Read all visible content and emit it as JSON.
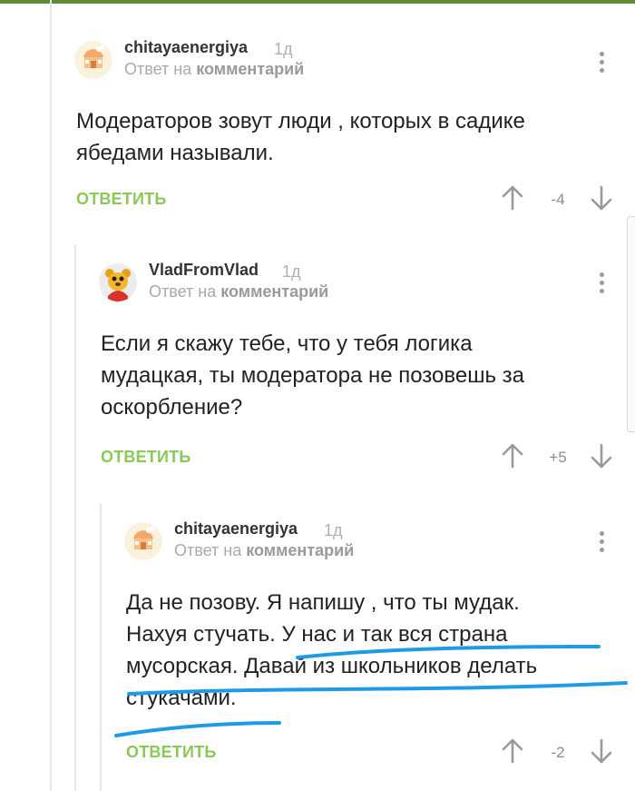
{
  "common": {
    "reply_to_prefix": "Ответ на",
    "reply_to_link": "комментарий",
    "reply_button": "ОТВЕТИТЬ"
  },
  "comments": [
    {
      "author": "chitayaenergiya",
      "time": "1д",
      "lines": [
        "Модераторов зовут люди , которых в садике",
        "ябедами называли."
      ],
      "rating": "-4"
    },
    {
      "author": "VladFromVlad",
      "time": "1д",
      "lines": [
        "Если я скажу тебе, что у тебя логика",
        "мудацкая, ты модератора не позовешь за",
        "оскорбление?"
      ],
      "rating": "+5"
    },
    {
      "author": "chitayaenergiya",
      "time": "1д",
      "lines": [
        "Да не позову. Я напишу , что ты мудак.",
        "Нахуя стучать.  У нас и так вся страна",
        "мусорская. Давай из школьников делать",
        "стукачами."
      ],
      "rating": "-2"
    }
  ],
  "colors": {
    "reply_button": "#8ac858",
    "highlight_stroke": "#1e9be6",
    "top_bar": "#5e8a3a"
  },
  "icons": [
    "user-avatar-icon",
    "bear-avatar-icon",
    "more-vertical-icon",
    "arrow-up-icon",
    "arrow-down-icon"
  ]
}
